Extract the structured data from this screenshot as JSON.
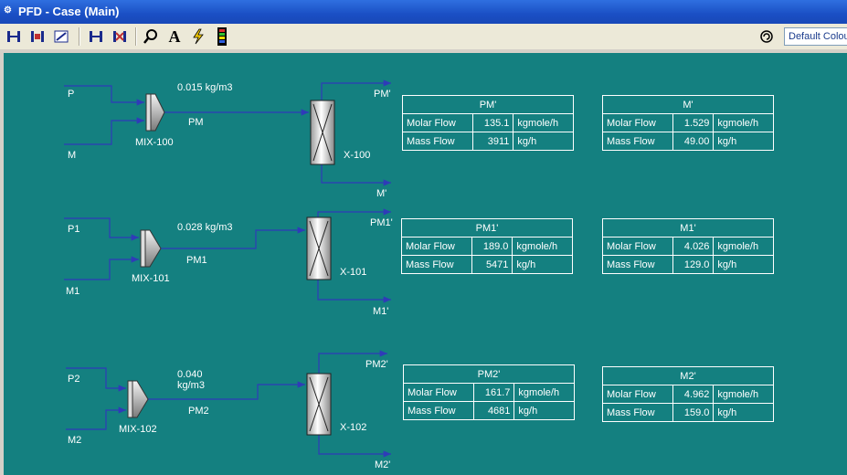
{
  "window": {
    "title": "PFD - Case (Main)"
  },
  "toolbar": {
    "colour_scheme": "Default Colour"
  },
  "streams": {
    "P": "P",
    "M": "M",
    "PM": "PM",
    "PMp": "PM'",
    "Mp": "M'",
    "P1": "P1",
    "M1": "M1",
    "PM1": "PM1",
    "PM1p": "PM1'",
    "M1p": "M1'",
    "P2": "P2",
    "M2": "M2",
    "PM2": "PM2",
    "PM2p": "PM2'",
    "M2p": "M2'"
  },
  "units": {
    "mix100": "MIX-100",
    "mix101": "MIX-101",
    "mix102": "MIX-102",
    "x100": "X-100",
    "x101": "X-101",
    "x102": "X-102"
  },
  "annotations": {
    "d1": "0.015 kg/m3",
    "d2": "0.028 kg/m3",
    "d3_line1": "0.040",
    "d3_line2": "kg/m3"
  },
  "workbooks": [
    {
      "name": "PM'",
      "rows": [
        {
          "label": "Molar Flow",
          "value": "135.1",
          "unit": "kgmole/h"
        },
        {
          "label": "Mass Flow",
          "value": "3911",
          "unit": "kg/h"
        }
      ]
    },
    {
      "name": "M'",
      "rows": [
        {
          "label": "Molar Flow",
          "value": "1.529",
          "unit": "kgmole/h"
        },
        {
          "label": "Mass Flow",
          "value": "49.00",
          "unit": "kg/h"
        }
      ]
    },
    {
      "name": "PM1'",
      "rows": [
        {
          "label": "Molar Flow",
          "value": "189.0",
          "unit": "kgmole/h"
        },
        {
          "label": "Mass Flow",
          "value": "5471",
          "unit": "kg/h"
        }
      ]
    },
    {
      "name": "M1'",
      "rows": [
        {
          "label": "Molar Flow",
          "value": "4.026",
          "unit": "kgmole/h"
        },
        {
          "label": "Mass Flow",
          "value": "129.0",
          "unit": "kg/h"
        }
      ]
    },
    {
      "name": "PM2'",
      "rows": [
        {
          "label": "Molar Flow",
          "value": "161.7",
          "unit": "kgmole/h"
        },
        {
          "label": "Mass Flow",
          "value": "4681",
          "unit": "kg/h"
        }
      ]
    },
    {
      "name": "M2'",
      "rows": [
        {
          "label": "Molar Flow",
          "value": "4.962",
          "unit": "kgmole/h"
        },
        {
          "label": "Mass Flow",
          "value": "159.0",
          "unit": "kg/h"
        }
      ]
    }
  ],
  "colors": {
    "canvas": "#148080",
    "stream": "#2f3bb8",
    "titlebar": "#1a4fc4"
  }
}
